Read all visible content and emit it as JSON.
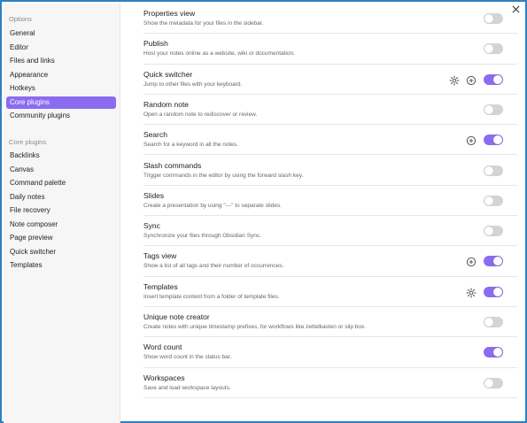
{
  "sidebar": {
    "options_heading": "Options",
    "options": [
      "General",
      "Editor",
      "Files and links",
      "Appearance",
      "Hotkeys",
      "Core plugins",
      "Community plugins"
    ],
    "active_index": 5,
    "core_heading": "Core plugins",
    "core": [
      "Backlinks",
      "Canvas",
      "Command palette",
      "Daily notes",
      "File recovery",
      "Note composer",
      "Page preview",
      "Quick switcher",
      "Templates"
    ]
  },
  "plugins": [
    {
      "name": "Properties view",
      "desc": "Show the metadata for your files in the sidebar.",
      "enabled": false
    },
    {
      "name": "Publish",
      "desc": "Host your notes online as a website, wiki or documentation.",
      "enabled": false
    },
    {
      "name": "Quick switcher",
      "desc": "Jump to other files with your keyboard.",
      "enabled": true
    },
    {
      "name": "Random note",
      "desc": "Open a random note to rediscover or review.",
      "enabled": false
    },
    {
      "name": "Search",
      "desc": "Search for a keyword in all the notes.",
      "enabled": true
    },
    {
      "name": "Slash commands",
      "desc": "Trigger commands in the editor by using the forward slash key.",
      "enabled": false
    },
    {
      "name": "Slides",
      "desc": "Create a presentation by using \"---\" to separate slides.",
      "enabled": false
    },
    {
      "name": "Sync",
      "desc": "Synchronize your files through Obsidian Sync.",
      "enabled": false
    },
    {
      "name": "Tags view",
      "desc": "Show a list of all tags and their number of occurrences.",
      "enabled": true
    },
    {
      "name": "Templates",
      "desc": "Insert template content from a folder of template files.",
      "enabled": true
    },
    {
      "name": "Unique note creator",
      "desc": "Create notes with unique timestamp prefixes, for workflows like zettelkasten or slip box.",
      "enabled": false
    },
    {
      "name": "Word count",
      "desc": "Show word count in the status bar.",
      "enabled": true
    },
    {
      "name": "Workspaces",
      "desc": "Save and load workspace layouts.",
      "enabled": false
    }
  ],
  "colors": {
    "accent": "#8b6cf0",
    "toggle_off": "#d4d4d4",
    "window_border": "#2f7fc1"
  }
}
